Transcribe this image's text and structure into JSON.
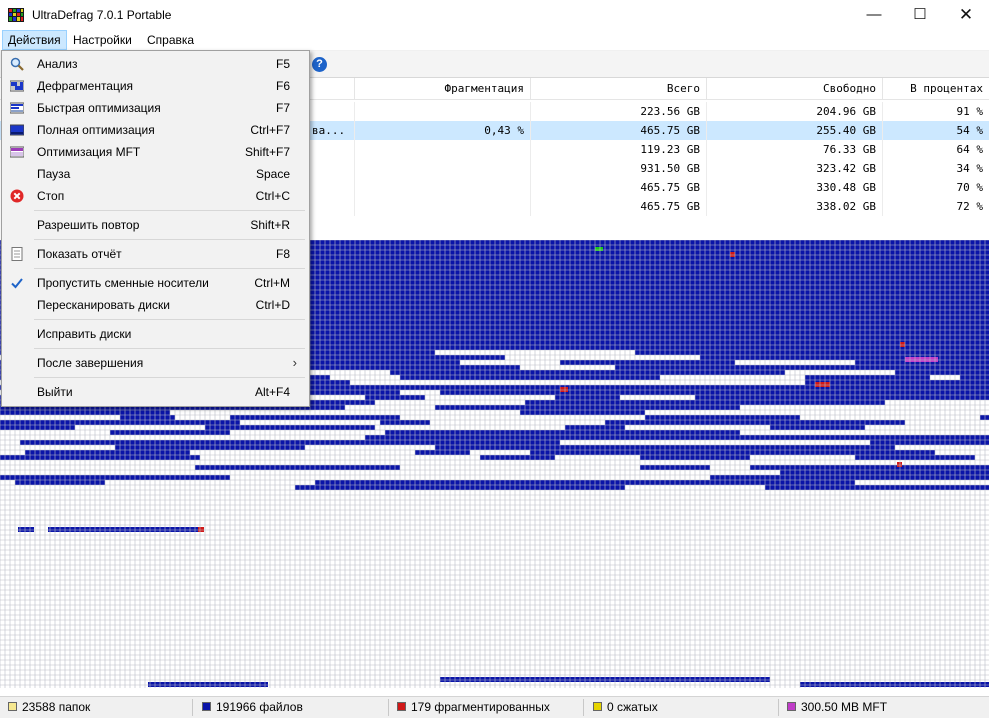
{
  "window": {
    "title": "UltraDefrag 7.0.1 Portable",
    "minimize_glyph": "—",
    "maximize_glyph": "☐",
    "close_glyph": "✕"
  },
  "menubar": {
    "actions": "Действия",
    "settings": "Настройки",
    "help": "Справка"
  },
  "toolbar": {
    "help_glyph": "?"
  },
  "table": {
    "columns": {
      "fragmentation": "Фрагментация",
      "total": "Всего",
      "free": "Свободно",
      "percent": "В процентах"
    },
    "rows": [
      {
        "name": "",
        "fragmentation": "",
        "total": "223.56 GB",
        "free": "204.96 GB",
        "percent": "91 %",
        "selected": false
      },
      {
        "name": "ва...",
        "fragmentation": "0,43 %",
        "total": "465.75 GB",
        "free": "255.40 GB",
        "percent": "54 %",
        "selected": true
      },
      {
        "name": "",
        "fragmentation": "",
        "total": "119.23 GB",
        "free": "76.33 GB",
        "percent": "64 %",
        "selected": false
      },
      {
        "name": "",
        "fragmentation": "",
        "total": "931.50 GB",
        "free": "323.42 GB",
        "percent": "34 %",
        "selected": false
      },
      {
        "name": "",
        "fragmentation": "",
        "total": "465.75 GB",
        "free": "330.48 GB",
        "percent": "70 %",
        "selected": false
      },
      {
        "name": "",
        "fragmentation": "",
        "total": "465.75 GB",
        "free": "338.02 GB",
        "percent": "72 %",
        "selected": false
      }
    ]
  },
  "menu": {
    "analyze": {
      "label": "Анализ",
      "shortcut": "F5",
      "icon": "magnifier-icon"
    },
    "defrag": {
      "label": "Дефрагментация",
      "shortcut": "F6",
      "icon": "defrag-icon"
    },
    "quick_optimize": {
      "label": "Быстрая оптимизация",
      "shortcut": "F7",
      "icon": "quick-optimize-icon"
    },
    "full_optimize": {
      "label": "Полная оптимизация",
      "shortcut": "Ctrl+F7",
      "icon": "full-optimize-icon"
    },
    "mft_optimize": {
      "label": "Оптимизация MFT",
      "shortcut": "Shift+F7",
      "icon": "mft-icon"
    },
    "pause": {
      "label": "Пауза",
      "shortcut": "Space"
    },
    "stop": {
      "label": "Стоп",
      "shortcut": "Ctrl+C",
      "icon": "stop-icon"
    },
    "repeat": {
      "label": "Разрешить повтор",
      "shortcut": "Shift+R"
    },
    "report": {
      "label": "Показать отчёт",
      "shortcut": "F8",
      "icon": "report-icon"
    },
    "skip_removable": {
      "label": "Пропустить сменные носители",
      "shortcut": "Ctrl+M",
      "checked": true
    },
    "rescan": {
      "label": "Пересканировать диски",
      "shortcut": "Ctrl+D"
    },
    "repair": {
      "label": "Исправить диски"
    },
    "after_finish": {
      "label": "После завершения",
      "submenu_glyph": "›"
    },
    "exit": {
      "label": "Выйти",
      "shortcut": "Alt+F4"
    }
  },
  "status": {
    "folders": "23588 папок",
    "files": "191966 файлов",
    "fragmented": "179 фрагментированных",
    "compressed": "0 сжатых",
    "mft": "300.50 MB MFT"
  },
  "colors": {
    "used": "#0a14a8",
    "free": "#ffffff",
    "grid": "#b9bcc6",
    "fragmented": "#d01818",
    "compressed": "#e6d400",
    "mft": "#c03cc8",
    "folder": "#f6e890",
    "system": "#18c818",
    "menu_hover": "#cce8ff"
  }
}
